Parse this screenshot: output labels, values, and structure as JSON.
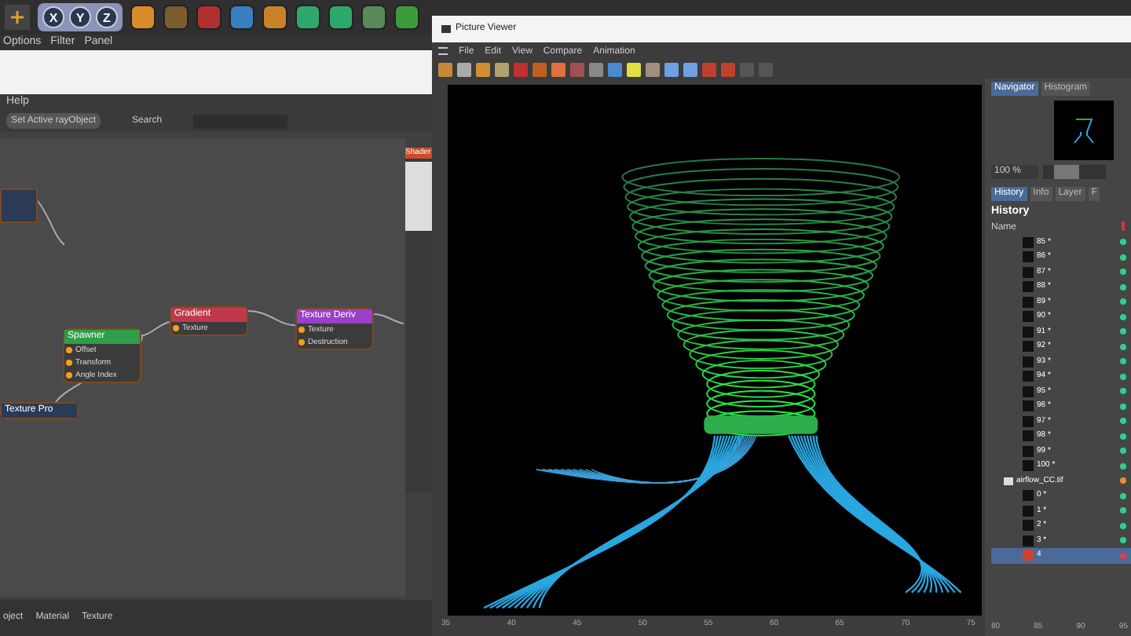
{
  "toolbar": {
    "axis_buttons": [
      "X",
      "Y",
      "Z"
    ]
  },
  "left_menu": [
    "Options",
    "Filter",
    "Panel"
  ],
  "node_editor": {
    "menu": [
      "Help"
    ],
    "set_active_button": "Set Active rayObject",
    "search_label": "Search",
    "shader_title": "Shader",
    "nodes": [
      {
        "title": "Spawner",
        "color": "#2e9e4a",
        "ports": [
          "Offset",
          "Transform",
          "Angle Index"
        ]
      },
      {
        "title": "Gradient",
        "color": "#c0394a",
        "ports": [
          "Texture"
        ]
      },
      {
        "title": "Texture Deriv",
        "color": "#9a3fc9",
        "ports": [
          "Texture",
          "Destruction"
        ]
      },
      {
        "title": "Texture Pro",
        "color": "#2b3a55"
      }
    ]
  },
  "bottom_tabs": [
    "oject",
    "Material",
    "Texture"
  ],
  "viewer": {
    "title": "Picture Viewer",
    "menu": [
      "File",
      "Edit",
      "View",
      "Compare",
      "Animation"
    ],
    "nav_tabs": [
      {
        "label": "Navigator",
        "selected": true
      },
      {
        "label": "Histogram",
        "selected": false
      }
    ],
    "zoom": "100 %",
    "zoom_slider": {
      "level": 0.3
    },
    "history_tabs": [
      {
        "label": "History",
        "selected": true
      },
      {
        "label": "Info",
        "selected": false
      },
      {
        "label": "Layer",
        "selected": false
      },
      {
        "label": "F",
        "selected": false
      }
    ],
    "history_heading": "History",
    "column": "Name",
    "rows": [
      {
        "label": "85 *",
        "kind": "frame",
        "color": "#2fd08a",
        "selected": false
      },
      {
        "label": "86 *",
        "kind": "frame",
        "color": "#2fd08a",
        "selected": false
      },
      {
        "label": "87 *",
        "kind": "frame",
        "color": "#2fd08a",
        "selected": false
      },
      {
        "label": "88 *",
        "kind": "frame",
        "color": "#2fd08a",
        "selected": false
      },
      {
        "label": "89 *",
        "kind": "frame",
        "color": "#2fd08a",
        "selected": false
      },
      {
        "label": "90 *",
        "kind": "frame",
        "color": "#2fd08a",
        "selected": false
      },
      {
        "label": "91 *",
        "kind": "frame",
        "color": "#2fd08a",
        "selected": false
      },
      {
        "label": "92 *",
        "kind": "frame",
        "color": "#2fd08a",
        "selected": false
      },
      {
        "label": "93 *",
        "kind": "frame",
        "color": "#2fd08a",
        "selected": false
      },
      {
        "label": "94 *",
        "kind": "frame",
        "color": "#2fd08a",
        "selected": false
      },
      {
        "label": "95 *",
        "kind": "frame",
        "color": "#2fd08a",
        "selected": false
      },
      {
        "label": "96 *",
        "kind": "frame",
        "color": "#2fd08a",
        "selected": false
      },
      {
        "label": "97 *",
        "kind": "frame",
        "color": "#2fd08a",
        "selected": false
      },
      {
        "label": "98 *",
        "kind": "frame",
        "color": "#2fd08a",
        "selected": false
      },
      {
        "label": "99 *",
        "kind": "frame",
        "color": "#2fd08a",
        "selected": false
      },
      {
        "label": "100 *",
        "kind": "frame",
        "color": "#2fd08a",
        "selected": false
      },
      {
        "label": "airflow_CC.tif",
        "kind": "folder",
        "color": "#e8902a",
        "selected": false
      },
      {
        "label": "0 *",
        "kind": "frame",
        "color": "#2fd08a",
        "selected": false
      },
      {
        "label": "1 *",
        "kind": "frame",
        "color": "#2fd08a",
        "selected": false
      },
      {
        "label": "2 *",
        "kind": "frame",
        "color": "#2fd08a",
        "selected": false
      },
      {
        "label": "3 *",
        "kind": "frame",
        "color": "#2fd08a",
        "selected": false
      },
      {
        "label": "4",
        "kind": "frame",
        "color": "#e04040",
        "selected": true
      }
    ],
    "timeline": [
      "35",
      "40",
      "45",
      "50",
      "55",
      "60",
      "65",
      "70",
      "75",
      "80",
      "85",
      "90",
      "95"
    ]
  }
}
